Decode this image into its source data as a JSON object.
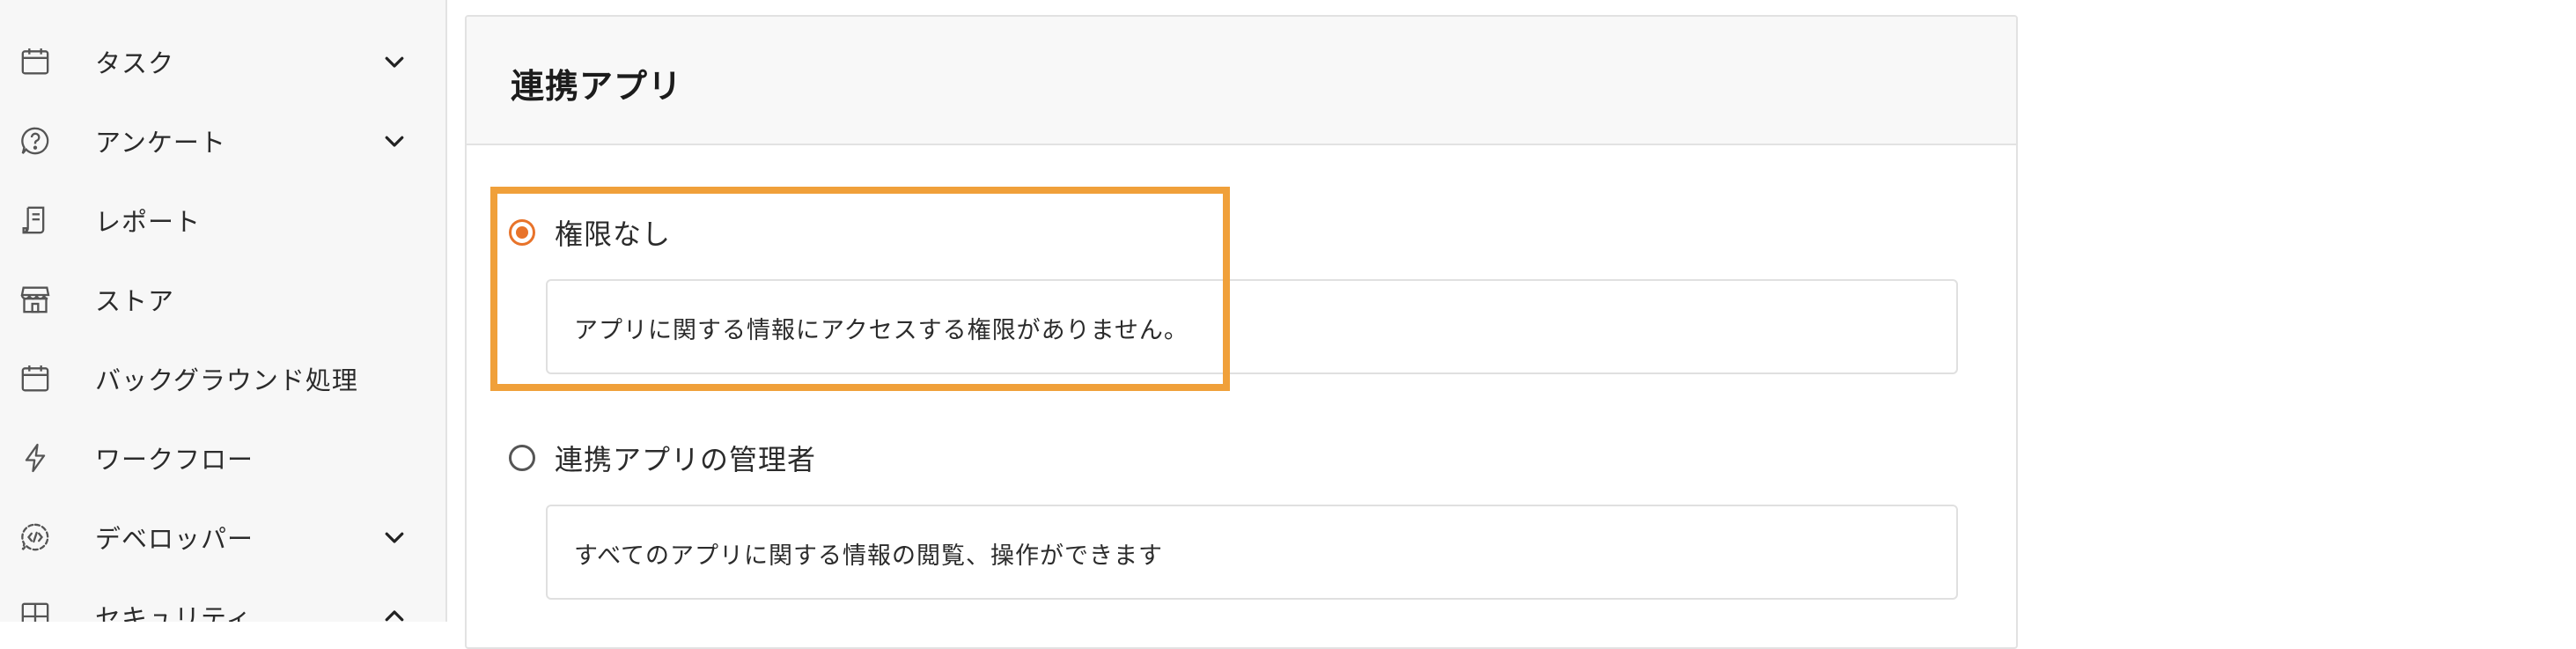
{
  "sidebar": {
    "items": [
      {
        "label": "タスク",
        "icon": "calendar-icon",
        "chevron": "down"
      },
      {
        "label": "アンケート",
        "icon": "question-circle-icon",
        "chevron": "down"
      },
      {
        "label": "レポート",
        "icon": "report-icon",
        "chevron": ""
      },
      {
        "label": "ストア",
        "icon": "store-icon",
        "chevron": ""
      },
      {
        "label": "バックグラウンド処理",
        "icon": "calendar-icon",
        "chevron": ""
      },
      {
        "label": "ワークフロー",
        "icon": "lightning-icon",
        "chevron": ""
      },
      {
        "label": "デベロッパー",
        "icon": "developer-icon",
        "chevron": "down"
      },
      {
        "label": "セキュリティ",
        "icon": "grid-icon",
        "chevron": "up"
      }
    ]
  },
  "main": {
    "title": "連携アプリ",
    "options": [
      {
        "label": "権限なし",
        "checked": true,
        "description": "アプリに関する情報にアクセスする権限がありません。"
      },
      {
        "label": "連携アプリの管理者",
        "checked": false,
        "description": "すべてのアプリに関する情報の閲覧、操作ができます"
      }
    ]
  },
  "colors": {
    "accent": "#e8732a",
    "highlight": "#f0a03a",
    "sidebar_bg": "#f7f7f7"
  }
}
